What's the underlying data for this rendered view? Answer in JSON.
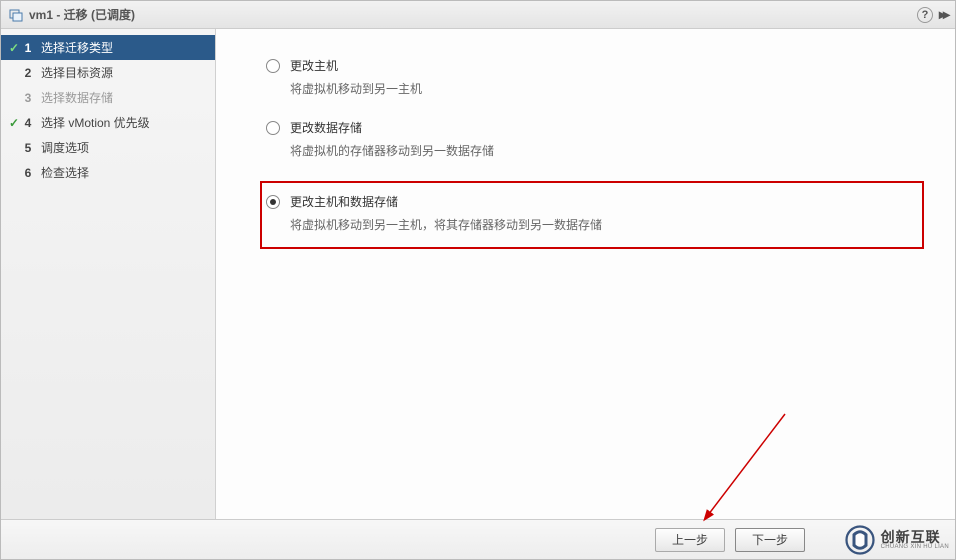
{
  "title": "vm1 - 迁移 (已调度)",
  "help_tooltip": "?",
  "steps": [
    {
      "num": "1",
      "label": "选择迁移类型",
      "checked": true,
      "active": true,
      "disabled": false
    },
    {
      "num": "2",
      "label": "选择目标资源",
      "checked": false,
      "active": false,
      "disabled": false
    },
    {
      "num": "3",
      "label": "选择数据存储",
      "checked": false,
      "active": false,
      "disabled": true
    },
    {
      "num": "4",
      "label": "选择 vMotion 优先级",
      "checked": true,
      "active": false,
      "disabled": false
    },
    {
      "num": "5",
      "label": "调度选项",
      "checked": false,
      "active": false,
      "disabled": false
    },
    {
      "num": "6",
      "label": "检查选择",
      "checked": false,
      "active": false,
      "disabled": false
    }
  ],
  "options": [
    {
      "title": "更改主机",
      "desc": "将虚拟机移动到另一主机",
      "selected": false,
      "highlight": false
    },
    {
      "title": "更改数据存储",
      "desc": "将虚拟机的存储器移动到另一数据存储",
      "selected": false,
      "highlight": false
    },
    {
      "title": "更改主机和数据存储",
      "desc": "将虚拟机移动到另一主机，将其存储器移动到另一数据存储",
      "selected": true,
      "highlight": true
    }
  ],
  "buttons": {
    "back": "上一步",
    "next": "下一步"
  },
  "watermark": {
    "cn": "创新互联",
    "en": "CHUANG XIN HU LIAN"
  }
}
